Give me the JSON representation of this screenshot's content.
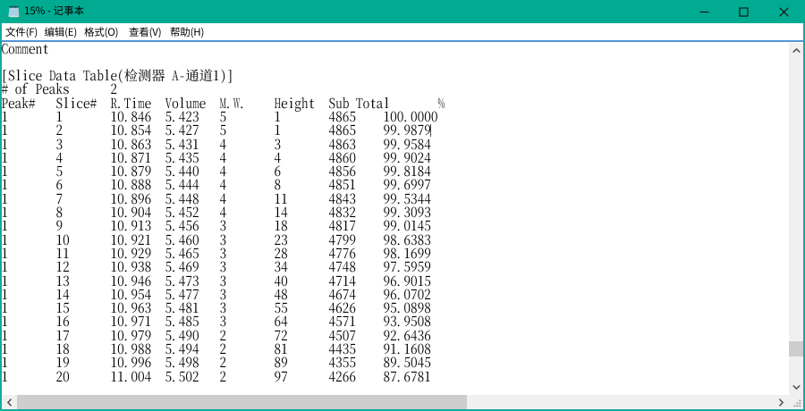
{
  "window": {
    "title": "15% - 记事本",
    "app_name": "记事本",
    "document_name": "15%",
    "controls": {
      "minimize_label": "最小化",
      "maximize_label": "最大化",
      "close_label": "关闭"
    }
  },
  "menu": {
    "items": [
      {
        "label": "文件(F)"
      },
      {
        "label": "编辑(E)"
      },
      {
        "label": "格式(O)"
      },
      {
        "label": "查看(V)"
      },
      {
        "label": "帮助(H)"
      }
    ]
  },
  "document": {
    "comment": "Comment",
    "section_header": "[Slice Data Table(检测器 A-通道1)]",
    "peaks_label": "# of Peaks",
    "peaks_count": "2",
    "caret_after": "99.9879",
    "table": {
      "columns": [
        "Peak#",
        "Slice#",
        "R.Time",
        "Volume",
        "M.W.",
        "Height",
        "Sub Total",
        "%"
      ],
      "rows": [
        [
          "1",
          "1",
          "10.846",
          "5.423",
          "5",
          "1",
          "4865",
          "100.0000"
        ],
        [
          "1",
          "2",
          "10.854",
          "5.427",
          "5",
          "1",
          "4865",
          "99.9879"
        ],
        [
          "1",
          "3",
          "10.863",
          "5.431",
          "4",
          "3",
          "4863",
          "99.9584"
        ],
        [
          "1",
          "4",
          "10.871",
          "5.435",
          "4",
          "4",
          "4860",
          "99.9024"
        ],
        [
          "1",
          "5",
          "10.879",
          "5.440",
          "4",
          "6",
          "4856",
          "99.8184"
        ],
        [
          "1",
          "6",
          "10.888",
          "5.444",
          "4",
          "8",
          "4851",
          "99.6997"
        ],
        [
          "1",
          "7",
          "10.896",
          "5.448",
          "4",
          "11",
          "4843",
          "99.5344"
        ],
        [
          "1",
          "8",
          "10.904",
          "5.452",
          "4",
          "14",
          "4832",
          "99.3093"
        ],
        [
          "1",
          "9",
          "10.913",
          "5.456",
          "3",
          "18",
          "4817",
          "99.0145"
        ],
        [
          "1",
          "10",
          "10.921",
          "5.460",
          "3",
          "23",
          "4799",
          "98.6383"
        ],
        [
          "1",
          "11",
          "10.929",
          "5.465",
          "3",
          "28",
          "4776",
          "98.1699"
        ],
        [
          "1",
          "12",
          "10.938",
          "5.469",
          "3",
          "34",
          "4748",
          "97.5959"
        ],
        [
          "1",
          "13",
          "10.946",
          "5.473",
          "3",
          "40",
          "4714",
          "96.9015"
        ],
        [
          "1",
          "14",
          "10.954",
          "5.477",
          "3",
          "48",
          "4674",
          "96.0702"
        ],
        [
          "1",
          "15",
          "10.963",
          "5.481",
          "3",
          "55",
          "4626",
          "95.0898"
        ],
        [
          "1",
          "16",
          "10.971",
          "5.485",
          "3",
          "64",
          "4571",
          "93.9508"
        ],
        [
          "1",
          "17",
          "10.979",
          "5.490",
          "2",
          "72",
          "4507",
          "92.6436"
        ],
        [
          "1",
          "18",
          "10.988",
          "5.494",
          "2",
          "81",
          "4435",
          "91.1608"
        ],
        [
          "1",
          "19",
          "10.996",
          "5.498",
          "2",
          "89",
          "4355",
          "89.5045"
        ],
        [
          "1",
          "20",
          "11.004",
          "5.502",
          "2",
          "97",
          "4266",
          "87.6781"
        ]
      ]
    }
  },
  "icons": {
    "app": "notepad-icon",
    "minimize": "minus",
    "maximize": "square-outline",
    "close": "x",
    "scroll_up": "chevron-up",
    "scroll_down": "chevron-down",
    "scroll_left": "chevron-left",
    "scroll_right": "chevron-right",
    "resize_grip": "diagonal-dots"
  },
  "colors": {
    "titlebar": "#00AB91",
    "window_border": "#10AC9C",
    "title_text": "#000000",
    "menu_bg": "#FFFFFF",
    "menu_text": "#000000",
    "menu_separator": "#5494D6",
    "text": "#000000",
    "background": "#FFFFFF",
    "scroll_track": "#F0F0F0",
    "scroll_thumb": "#CDCDCD",
    "scroll_arrow": "#505050",
    "caret": "#4A4A4A"
  }
}
